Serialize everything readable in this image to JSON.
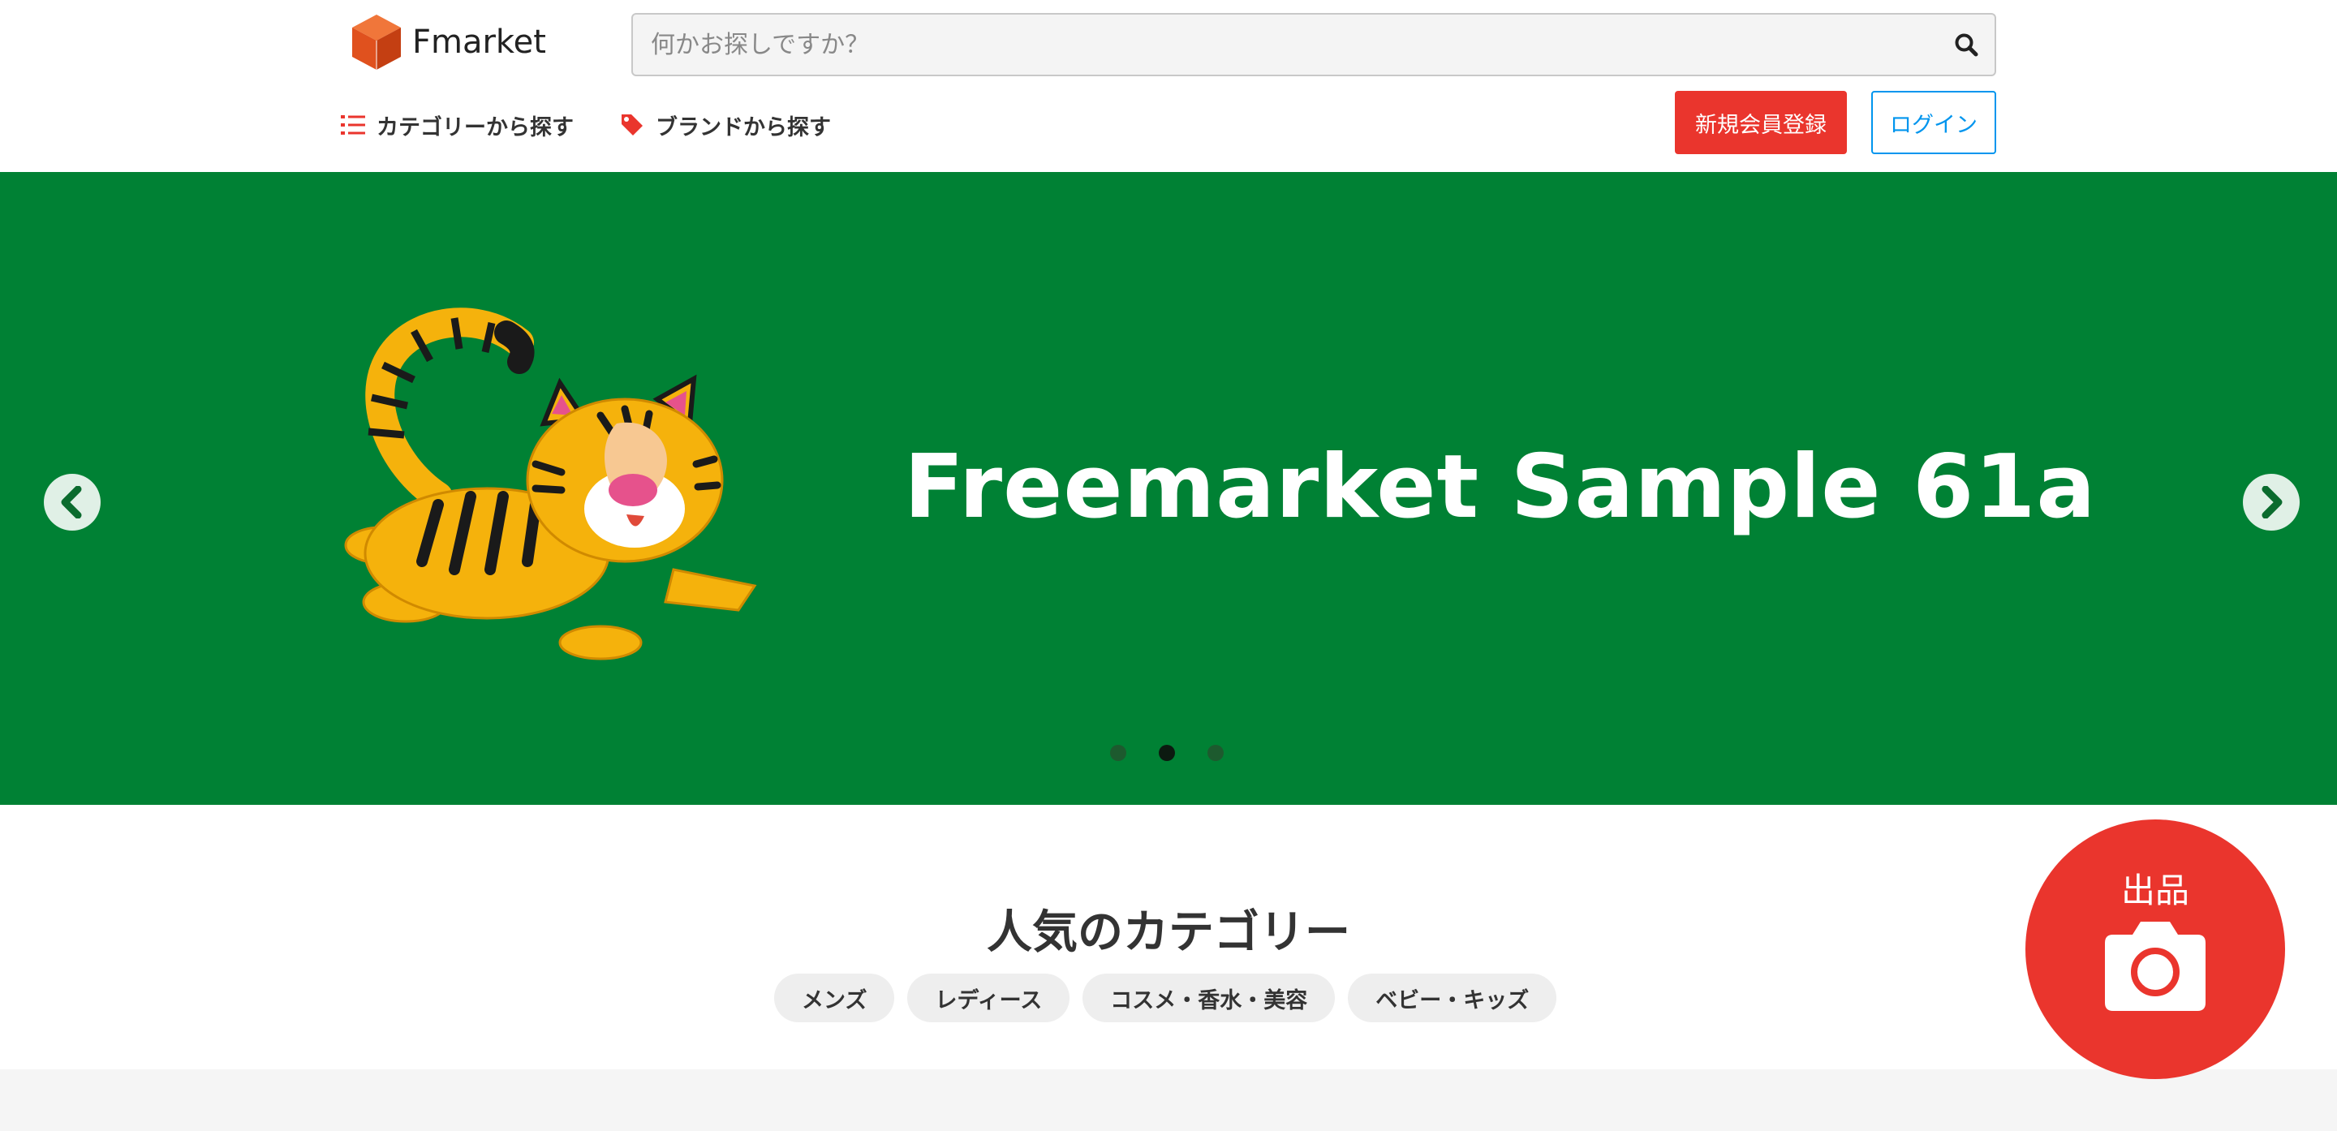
{
  "header": {
    "logo_text": "Fmarket",
    "search": {
      "placeholder": "何かお探しですか？",
      "value": ""
    },
    "nav": {
      "category": "カテゴリーから探す",
      "brand": "ブランドから探す"
    },
    "signup_label": "新規会員登録",
    "login_label": "ログイン"
  },
  "hero": {
    "title": "Freemarket Sample 61a",
    "slides": 3,
    "active_slide": 2
  },
  "popular": {
    "title": "人気のカテゴリー",
    "categories": [
      "メンズ",
      "レディース",
      "コスメ・香水・美容",
      "ベビー・キッズ"
    ]
  },
  "sell": {
    "label": "出品"
  },
  "colors": {
    "brand_red": "#ea352d",
    "login_blue": "#0095ee",
    "hero_green": "#008134",
    "logo_orange": "#e0511e"
  },
  "icons": [
    "logo-cube-icon",
    "search-icon",
    "list-icon",
    "tag-icon",
    "chevron-left-icon",
    "chevron-right-icon",
    "camera-icon"
  ]
}
